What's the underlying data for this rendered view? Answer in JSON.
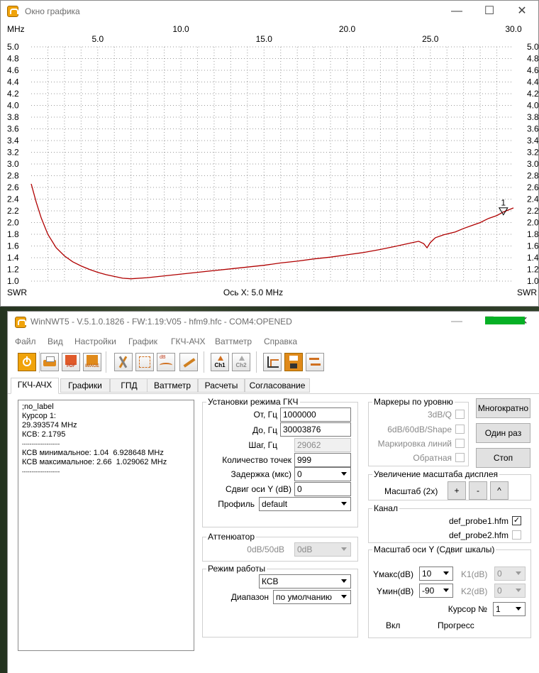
{
  "graph_window": {
    "title": "Окно графика",
    "top_left_unit": "MHz",
    "left_bottom_label": "SWR",
    "right_bottom_label": "SWR",
    "axis_info": "Ось X: 5.0 MHz",
    "marker_label": "1"
  },
  "chart_data": {
    "type": "line",
    "x_tick_labels": [
      "5.0",
      "10.0",
      "15.0",
      "20.0",
      "25.0",
      "30.0"
    ],
    "y_tick_labels": [
      "5.0",
      "4.8",
      "4.6",
      "4.4",
      "4.2",
      "4.0",
      "3.8",
      "3.6",
      "3.4",
      "3.2",
      "3.0",
      "2.8",
      "2.6",
      "2.4",
      "2.2",
      "2.0",
      "1.8",
      "1.6",
      "1.4",
      "1.2",
      "1.0"
    ],
    "xlim": [
      1.0,
      30.0
    ],
    "ylim": [
      1.0,
      5.0
    ],
    "grid": true,
    "series": [
      {
        "color": "#b00000",
        "x": [
          1.0,
          1.3,
          1.6,
          2.0,
          2.5,
          3.0,
          3.5,
          4.0,
          4.5,
          5.0,
          5.5,
          6.0,
          6.5,
          7.0,
          8.0,
          9.0,
          10.0,
          11.0,
          12.0,
          13.0,
          14.0,
          15.0,
          16.0,
          17.0,
          18.0,
          19.0,
          20.0,
          21.0,
          22.0,
          23.0,
          23.8,
          24.3,
          24.6,
          24.8,
          25.0,
          25.3,
          25.8,
          26.5,
          27.0,
          27.5,
          28.0,
          28.5,
          29.0,
          29.39,
          30.0
        ],
        "y": [
          2.66,
          2.35,
          2.08,
          1.8,
          1.57,
          1.43,
          1.33,
          1.26,
          1.2,
          1.15,
          1.11,
          1.08,
          1.05,
          1.04,
          1.06,
          1.09,
          1.12,
          1.15,
          1.18,
          1.21,
          1.24,
          1.27,
          1.31,
          1.34,
          1.38,
          1.41,
          1.45,
          1.49,
          1.54,
          1.6,
          1.65,
          1.68,
          1.64,
          1.57,
          1.66,
          1.74,
          1.79,
          1.84,
          1.9,
          1.95,
          2.0,
          2.07,
          2.12,
          2.18,
          2.25
        ]
      }
    ],
    "cursor": {
      "x": 29.393574,
      "y": 2.1795
    }
  },
  "main_window": {
    "title": "WinNWT5 - V.5.1.0.1826 - FW:1.19:V05 - hfm9.hfc - COM4:OPENED",
    "menu": [
      "Файл",
      "Вид",
      "Настройки",
      "График",
      "ГКЧ-АЧХ",
      "Ваттметр",
      "Справка"
    ],
    "toolbar_icons": [
      "power-icon",
      "print-icon",
      "pdf-icon",
      "image-icon",
      "settings-tools-icon",
      "calibrate-icon",
      "db-icon",
      "tuning-icon",
      "ch1-icon",
      "ch2-icon",
      "chart-icon",
      "save-icon",
      "export-icon"
    ],
    "toolbar_texts": {
      "pdf": "PDF",
      "image": "IMAGE",
      "db": "dB",
      "ch1": "Ch1",
      "ch2": "Ch2"
    },
    "tabs": [
      "ГКЧ-АЧХ",
      "Графики",
      "ГПД",
      "Ваттметр",
      "Расчеты",
      "Согласование"
    ],
    "info_lines": [
      ";no_label",
      "",
      "Курсор 1:",
      "29.393574 MHz",
      "КСВ: 2.1795",
      "--------------------",
      "КСВ минимальное: 1.04  6.928648 MHz",
      "КСВ максимальное: 2.66  1.029062 MHz",
      "--------------------"
    ],
    "sweep": {
      "legend": "Установки режима ГКЧ",
      "from_label": "От, Гц",
      "from_value": "1000000",
      "to_label": "До, Гц",
      "to_value": "30003876",
      "step_label": "Шаг, Гц",
      "step_value": "29062",
      "points_label": "Количество точек",
      "points_value": "999",
      "delay_label": "Задержка (мкс)",
      "delay_value": "0",
      "yshift_label": "Сдвиг оси Y (dB)",
      "yshift_value": "0",
      "profile_label": "Профиль",
      "profile_value": "default"
    },
    "attenuator": {
      "legend": "Аттенюатор",
      "label": "0dB/50dB",
      "value": "0dB"
    },
    "mode": {
      "legend": "Режим работы",
      "value": "КСВ",
      "range_label": "Диапазон",
      "range_value": "по умолчанию"
    },
    "markers": {
      "legend": "Маркеры по уровню",
      "q3db": "3dB/Q",
      "db6060": "6dB/60dB/Shape",
      "lines": "Маркировка линий",
      "reverse": "Обратная"
    },
    "buttons": {
      "multi": "Многократно",
      "once": "Один раз",
      "stop": "Стоп"
    },
    "zoom": {
      "legend": "Увеличение масштаба дисплея",
      "label": "Масштаб (2x)",
      "plus": "+",
      "minus": "-",
      "up": "^"
    },
    "channel": {
      "legend": "Канал",
      "probe1": "def_probe1.hfm",
      "probe2": "def_probe2.hfm",
      "probe1_checked": "✓"
    },
    "yscale": {
      "legend": "Масштаб оси Y (Сдвиг шкалы)",
      "ymax_label": "Yмакс(dB)",
      "ymax_value": "10",
      "ymin_label": "Yмин(dB)",
      "ymin_value": "-90",
      "k1_label": "K1(dB)",
      "k1_value": "0",
      "k2_label": "K2(dB)",
      "k2_value": "0",
      "cursor_label": "Курсор №",
      "cursor_value": "1",
      "on_label": "Вкл",
      "progress_label": "Прогресс",
      "progress": 1.0
    }
  }
}
